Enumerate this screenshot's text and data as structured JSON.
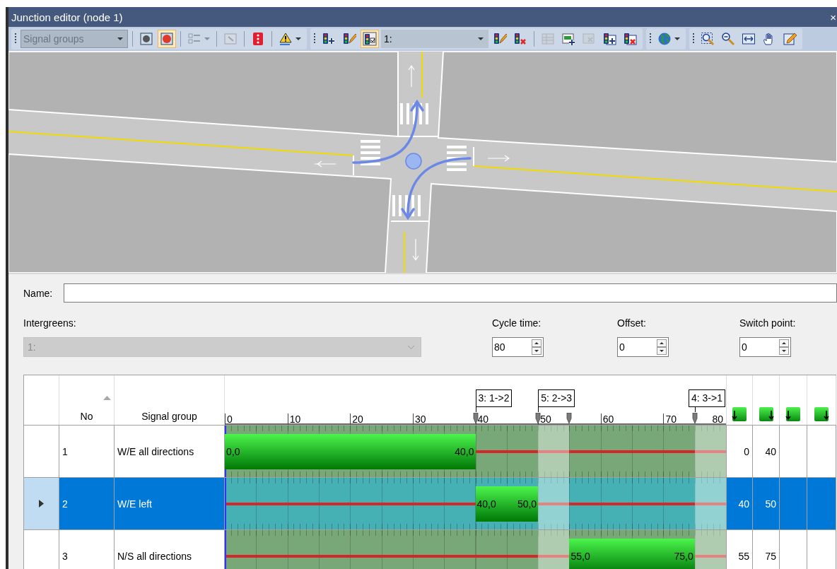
{
  "window": {
    "title": "Junction editor (node 1)",
    "close": "×"
  },
  "toolbar": {
    "groups": [
      {
        "items": [
          {
            "kind": "dropdown",
            "value": "Signal groups",
            "disabled": true
          },
          {
            "kind": "separator"
          },
          {
            "kind": "button",
            "pressed": false,
            "disabled": false
          },
          {
            "kind": "button",
            "pressed": true,
            "disabled": false
          },
          {
            "kind": "separator"
          },
          {
            "kind": "menu-button",
            "pressed": false,
            "disabled": true
          },
          {
            "kind": "separator"
          },
          {
            "kind": "button",
            "pressed": false,
            "disabled": true
          },
          {
            "kind": "separator"
          },
          {
            "kind": "button",
            "pressed": false,
            "disabled": false
          },
          {
            "kind": "separator"
          },
          {
            "kind": "menu-button",
            "pressed": false,
            "disabled": false
          }
        ]
      },
      {
        "items": [
          {
            "kind": "button",
            "pressed": false,
            "disabled": false
          },
          {
            "kind": "button",
            "pressed": false,
            "disabled": false
          },
          {
            "kind": "button",
            "pressed": true,
            "disabled": false
          },
          {
            "kind": "dropdown",
            "value": "1:",
            "disabled": false
          },
          {
            "kind": "button",
            "pressed": false,
            "disabled": false
          },
          {
            "kind": "button",
            "pressed": false,
            "disabled": false
          },
          {
            "kind": "separator"
          },
          {
            "kind": "button",
            "pressed": false,
            "disabled": true
          },
          {
            "kind": "button",
            "pressed": false,
            "disabled": false
          },
          {
            "kind": "button",
            "pressed": false,
            "disabled": true
          },
          {
            "kind": "button",
            "pressed": false,
            "disabled": false
          },
          {
            "kind": "button",
            "pressed": false,
            "disabled": false
          }
        ]
      },
      {
        "items": [
          {
            "kind": "menu-button",
            "pressed": false,
            "disabled": false
          }
        ]
      },
      {
        "items": [
          {
            "kind": "button",
            "pressed": false,
            "disabled": false
          },
          {
            "kind": "button",
            "pressed": false,
            "disabled": false
          },
          {
            "kind": "button",
            "pressed": false,
            "disabled": false
          },
          {
            "kind": "button",
            "pressed": false,
            "disabled": false
          },
          {
            "kind": "button",
            "pressed": false,
            "disabled": false
          }
        ]
      }
    ]
  },
  "form": {
    "name": {
      "label": "Name:"
    },
    "intergreens": {
      "label": "Intergreens:",
      "value": "1:",
      "disabled": true
    },
    "cycle_time": {
      "label": "Cycle time:",
      "value": "80"
    },
    "offset": {
      "label": "Offset:",
      "value": "0"
    },
    "switch_point": {
      "label": "Switch point:",
      "value": "0"
    }
  },
  "table": {
    "columns": [
      {
        "kind": "indicator"
      },
      {
        "kind": "text",
        "label": "No",
        "sorted": true
      },
      {
        "kind": "text",
        "label": "Signal group"
      },
      {
        "kind": "timeline",
        "ticks": [
          "0",
          "10",
          "20",
          "30",
          "40",
          "50",
          "60",
          "70",
          "80"
        ]
      },
      {
        "kind": "green-start"
      },
      {
        "kind": "green-end"
      },
      {
        "kind": "green-start"
      },
      {
        "kind": "green-end"
      }
    ],
    "rows": [
      {
        "no": "1",
        "name": "W/E all directions",
        "green_start": "0,0",
        "green_end": "40,0",
        "intergreen": "3: 1->2",
        "values": [
          "0",
          "40"
        ],
        "selected": false
      },
      {
        "no": "2",
        "name": "W/E left",
        "green_start": "40,0",
        "green_end": "50,0",
        "intergreen": "5: 2->3",
        "values": [
          "40",
          "50"
        ],
        "selected": true
      },
      {
        "no": "3",
        "name": "N/S all directions",
        "green_start": "55,0",
        "green_end": "75,0",
        "intergreen": "4: 3->1",
        "values": [
          "55",
          "75"
        ],
        "selected": false
      }
    ]
  }
}
